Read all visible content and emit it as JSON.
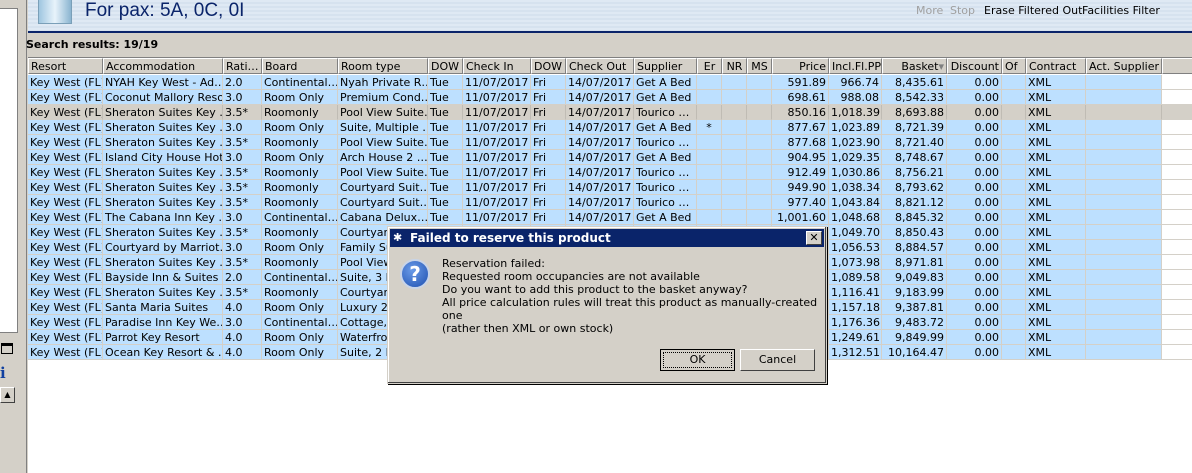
{
  "header": {
    "title": "For pax: 5A, 0C, 0I",
    "buttons": [
      "More",
      "Stop",
      "Erase Filtered Out",
      "Facilities Filter"
    ]
  },
  "results_label": "Search results: 19/19",
  "columns": [
    "Resort",
    "Accommodation",
    "Rati…",
    "Board",
    "Room type",
    "DOW",
    "Check In",
    "DOW",
    "Check Out",
    "Supplier",
    "Er",
    "NR",
    "MS",
    "Price",
    "Incl.Fl.PP",
    "Basket",
    "Discount",
    "Of",
    "Contract",
    "Act. Supplier"
  ],
  "sort_column": "Basket",
  "selected_row": 2,
  "rows": [
    [
      "Key West (FL)",
      "NYAH Key West - Ad…",
      "2.0",
      "Continental…",
      "Nyah Private R…",
      "Tue",
      "11/07/2017",
      "Fri",
      "14/07/2017",
      "Get A Bed",
      "",
      "",
      "",
      "591.89",
      "966.74",
      "8,435.61",
      "0.00",
      "",
      "XML",
      ""
    ],
    [
      "Key West (FL)",
      "Coconut Mallory Resort",
      "3.0",
      "Room Only",
      "Premium Cond…",
      "Tue",
      "11/07/2017",
      "Fri",
      "14/07/2017",
      "Get A Bed",
      "",
      "",
      "",
      "698.61",
      "988.08",
      "8,542.33",
      "0.00",
      "",
      "XML",
      ""
    ],
    [
      "Key West (FL)",
      "Sheraton Suites Key …",
      "3.5*",
      "Roomonly",
      "Pool View Suite…",
      "Tue",
      "11/07/2017",
      "Fri",
      "14/07/2017",
      "Tourico …",
      "",
      "",
      "",
      "850.16",
      "1,018.39",
      "8,693.88",
      "0.00",
      "",
      "XML",
      ""
    ],
    [
      "Key West (FL)",
      "Sheraton Suites Key …",
      "3.0",
      "Room Only",
      "Suite, Multiple …",
      "Tue",
      "11/07/2017",
      "Fri",
      "14/07/2017",
      "Get A Bed",
      "*",
      "",
      "",
      "877.67",
      "1,023.89",
      "8,721.39",
      "0.00",
      "",
      "XML",
      ""
    ],
    [
      "Key West (FL)",
      "Sheraton Suites Key …",
      "3.5*",
      "Roomonly",
      "Pool View Suite…",
      "Tue",
      "11/07/2017",
      "Fri",
      "14/07/2017",
      "Tourico …",
      "",
      "",
      "",
      "877.68",
      "1,023.90",
      "8,721.40",
      "0.00",
      "",
      "XML",
      ""
    ],
    [
      "Key West (FL)",
      "Island City House Hotel",
      "3.0",
      "Room Only",
      "Arch House 2 …",
      "Tue",
      "11/07/2017",
      "Fri",
      "14/07/2017",
      "Get A Bed",
      "",
      "",
      "",
      "904.95",
      "1,029.35",
      "8,748.67",
      "0.00",
      "",
      "XML",
      ""
    ],
    [
      "Key West (FL)",
      "Sheraton Suites Key …",
      "3.5*",
      "Roomonly",
      "Pool View Suite…",
      "Tue",
      "11/07/2017",
      "Fri",
      "14/07/2017",
      "Tourico …",
      "",
      "",
      "",
      "912.49",
      "1,030.86",
      "8,756.21",
      "0.00",
      "",
      "XML",
      ""
    ],
    [
      "Key West (FL)",
      "Sheraton Suites Key …",
      "3.5*",
      "Roomonly",
      "Courtyard Suit…",
      "Tue",
      "11/07/2017",
      "Fri",
      "14/07/2017",
      "Tourico …",
      "",
      "",
      "",
      "949.90",
      "1,038.34",
      "8,793.62",
      "0.00",
      "",
      "XML",
      ""
    ],
    [
      "Key West (FL)",
      "Sheraton Suites Key …",
      "3.5*",
      "Roomonly",
      "Courtyard Suit…",
      "Tue",
      "11/07/2017",
      "Fri",
      "14/07/2017",
      "Tourico …",
      "",
      "",
      "",
      "977.40",
      "1,043.84",
      "8,821.12",
      "0.00",
      "",
      "XML",
      ""
    ],
    [
      "Key West (FL)",
      "The Cabana Inn Key …",
      "3.0",
      "Continental…",
      "Cabana Delux…",
      "Tue",
      "11/07/2017",
      "Fri",
      "14/07/2017",
      "Get A Bed",
      "",
      "",
      "",
      "1,001.60",
      "1,048.68",
      "8,845.32",
      "0.00",
      "",
      "XML",
      ""
    ],
    [
      "Key West (FL)",
      "Sheraton Suites Key …",
      "3.5*",
      "Roomonly",
      "Courtyard",
      "",
      "",
      "",
      "",
      "",
      "",
      "",
      "",
      "",
      "1,049.70",
      "8,850.43",
      "0.00",
      "",
      "XML",
      ""
    ],
    [
      "Key West (FL)",
      "Courtyard by Marriot…",
      "3.0",
      "Room Only",
      "Family Su",
      "",
      "",
      "",
      "",
      "",
      "",
      "",
      "",
      "",
      "1,056.53",
      "8,884.57",
      "0.00",
      "",
      "XML",
      ""
    ],
    [
      "Key West (FL)",
      "Sheraton Suites Key …",
      "3.5*",
      "Roomonly",
      "Pool View",
      "",
      "",
      "",
      "",
      "",
      "",
      "",
      "",
      "",
      "1,073.98",
      "8,971.81",
      "0.00",
      "",
      "XML",
      ""
    ],
    [
      "Key West (FL)",
      "Bayside Inn & Suites",
      "2.0",
      "Continental…",
      "Suite, 3 B",
      "",
      "",
      "",
      "",
      "",
      "",
      "",
      "",
      "",
      "1,089.58",
      "9,049.83",
      "0.00",
      "",
      "XML",
      ""
    ],
    [
      "Key West (FL)",
      "Sheraton Suites Key …",
      "3.5*",
      "Roomonly",
      "Courtyard",
      "",
      "",
      "",
      "",
      "",
      "",
      "",
      "",
      "",
      "1,116.41",
      "9,183.99",
      "0.00",
      "",
      "XML",
      ""
    ],
    [
      "Key West (FL)",
      "Santa Maria Suites",
      "4.0",
      "Room Only",
      "Luxury 2",
      "",
      "",
      "",
      "",
      "",
      "",
      "",
      "",
      "",
      "1,157.18",
      "9,387.81",
      "0.00",
      "",
      "XML",
      ""
    ],
    [
      "Key West (FL)",
      "Paradise Inn Key We…",
      "3.0",
      "Continental…",
      "Cottage,",
      "",
      "",
      "",
      "",
      "",
      "",
      "",
      "",
      "",
      "1,176.36",
      "9,483.72",
      "0.00",
      "",
      "XML",
      ""
    ],
    [
      "Key West (FL)",
      "Parrot Key Resort",
      "4.0",
      "Room Only",
      "Waterfro",
      "",
      "",
      "",
      "",
      "",
      "",
      "",
      "",
      "",
      "1,249.61",
      "9,849.99",
      "0.00",
      "",
      "XML",
      ""
    ],
    [
      "Key West (FL)",
      "Ocean Key Resort & …",
      "4.0",
      "Room Only",
      "Suite, 2 B",
      "",
      "",
      "",
      "",
      "",
      "",
      "",
      "",
      "",
      "1,312.51",
      "10,164.47",
      "0.00",
      "",
      "XML",
      ""
    ]
  ],
  "dialog": {
    "title": "Failed to reserve this product",
    "close": "✕",
    "icon": "question-icon",
    "lines": [
      "Reservation failed:",
      "Requested room occupancies are not available",
      "Do you want to add this product to the basket anyway?",
      "All price calculation rules will treat this product as manually-created one",
      "(rather then XML or own stock)"
    ],
    "ok": "OK",
    "cancel": "Cancel"
  },
  "colors": {
    "row": "#bde0ff",
    "selected": "#d4d0c8",
    "titlebar": "#0a246a"
  }
}
